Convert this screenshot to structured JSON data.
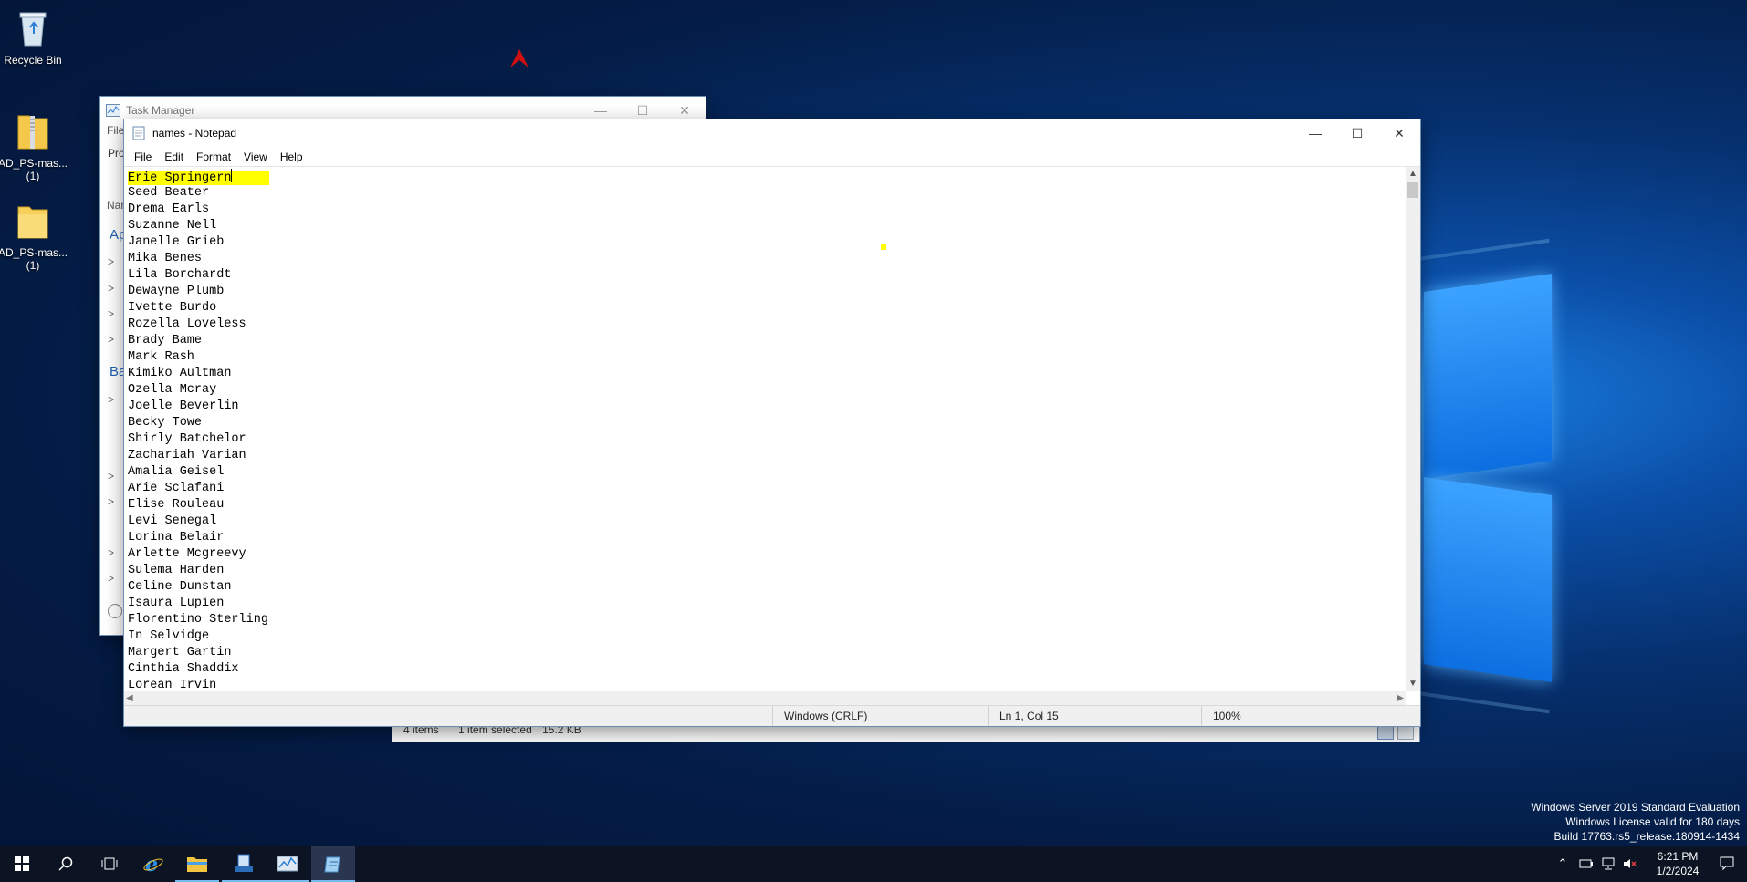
{
  "desktop": {
    "icons": [
      {
        "label": "Recycle Bin",
        "icon": "recycle-bin-icon"
      },
      {
        "label": "AD_PS-mas...\n(1)",
        "icon": "zip-folder-icon"
      },
      {
        "label": "AD_PS-mas...\n(1)",
        "icon": "folder-icon"
      }
    ],
    "watermark": {
      "line1": "Windows Server 2019 Standard Evaluation",
      "line2": "Windows License valid for 180 days",
      "line3": "Build 17763.rs5_release.180914-1434"
    }
  },
  "task_manager": {
    "title": "Task Manager",
    "menu_file": "File",
    "tab_processes": "Pro",
    "col_name": "Nam",
    "section_apps": "Ap",
    "section_bg": "Ba"
  },
  "explorer_status": {
    "items": "4 items",
    "selected": "1 item selected",
    "size": "15.2 KB"
  },
  "notepad": {
    "title": "names - Notepad",
    "menu": {
      "file": "File",
      "edit": "Edit",
      "format": "Format",
      "view": "View",
      "help": "Help"
    },
    "first_line_selected": "Erie Springern",
    "lines": [
      "Seed Beater",
      "Drema Earls",
      "Suzanne Nell",
      "Janelle Grieb",
      "Mika Benes",
      "Lila Borchardt",
      "Dewayne Plumb",
      "Ivette Burdo",
      "Rozella Loveless",
      "Brady Bame",
      "Mark Rash",
      "Kimiko Aultman",
      "Ozella Mcray",
      "Joelle Beverlin",
      "Becky Towe",
      "Shirly Batchelor",
      "Zachariah Varian",
      "Amalia Geisel",
      "Arie Sclafani",
      "Elise Rouleau",
      "Levi Senegal",
      "Lorina Belair",
      "Arlette Mcgreevy",
      "Sulema Harden",
      "Celine Dunstan",
      "Isaura Lupien",
      "Florentino Sterling",
      "In Selvidge",
      "Margert Gartin",
      "Cinthia Shaddix",
      "Lorean Irvin"
    ],
    "status": {
      "encoding": "Windows (CRLF)",
      "position": "Ln 1, Col 15",
      "zoom": "100%"
    }
  },
  "taskbar": {
    "time": "6:21 PM",
    "date": "1/2/2024"
  }
}
